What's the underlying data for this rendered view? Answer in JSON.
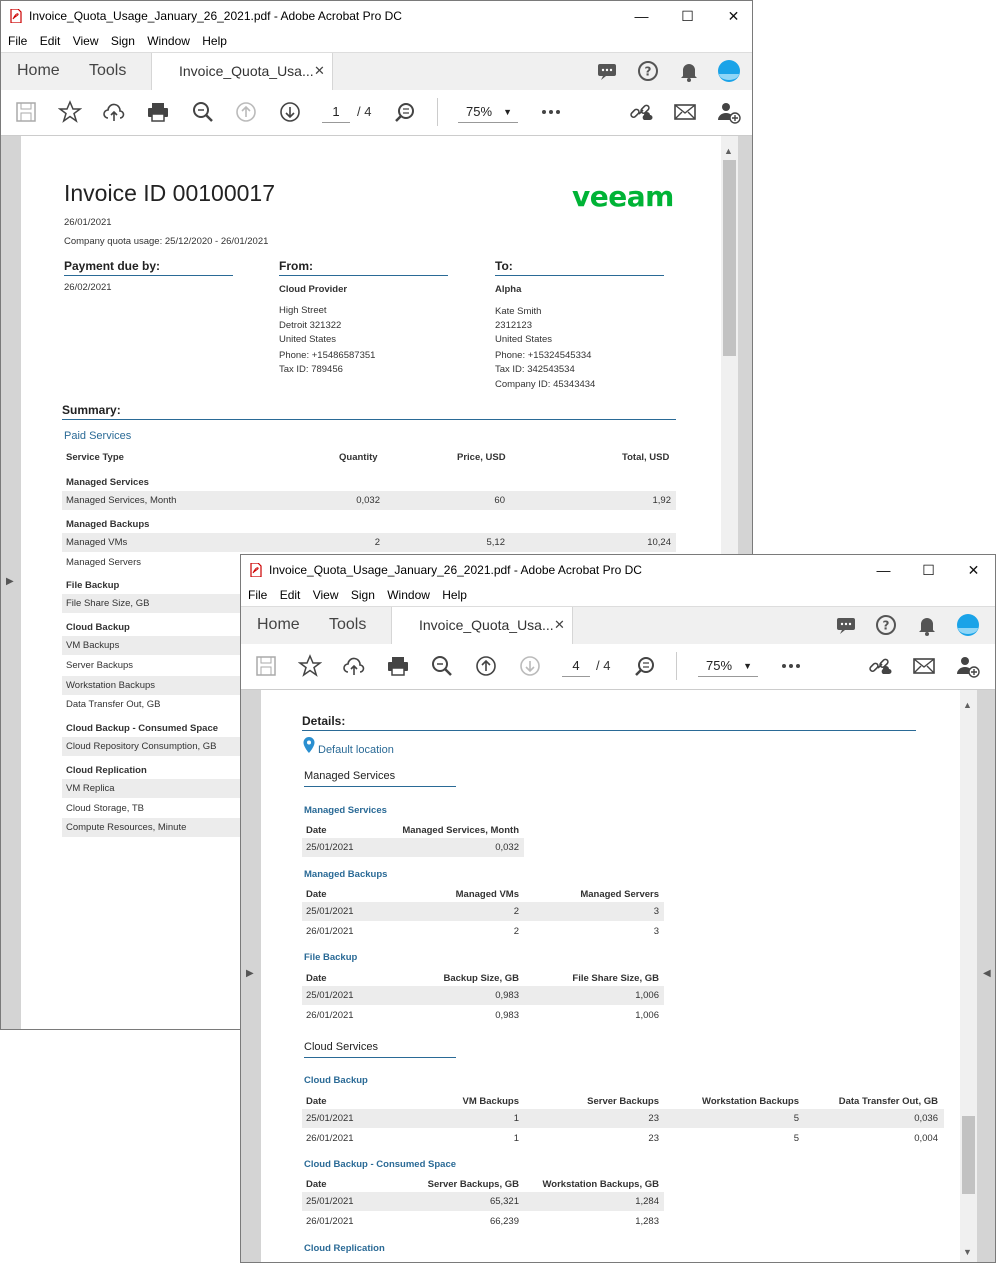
{
  "window1": {
    "title": "Invoice_Quota_Usage_January_26_2021.pdf - Adobe Acrobat Pro DC",
    "menu": [
      "File",
      "Edit",
      "View",
      "Sign",
      "Window",
      "Help"
    ],
    "tabs": {
      "home": "Home",
      "tools": "Tools",
      "doc": "Invoice_Quota_Usa..."
    },
    "page_current": "1",
    "page_total": "/ 4",
    "zoom": "75%"
  },
  "window2": {
    "title": "Invoice_Quota_Usage_January_26_2021.pdf - Adobe Acrobat Pro DC",
    "menu": [
      "File",
      "Edit",
      "View",
      "Sign",
      "Window",
      "Help"
    ],
    "tabs": {
      "home": "Home",
      "tools": "Tools",
      "doc": "Invoice_Quota_Usa..."
    },
    "page_current": "4",
    "page_total": "/ 4",
    "zoom": "75%"
  },
  "invoice": {
    "title": "Invoice ID 00100017",
    "logo": "veeam",
    "date": "26/01/2021",
    "quota": "Company quota usage: 25/12/2020 - 26/01/2021",
    "payment_due_label": "Payment due by:",
    "payment_due": "26/02/2021",
    "from_label": "From:",
    "from": {
      "name": "Cloud Provider",
      "street": "High Street",
      "city": "Detroit 321322",
      "country": "United States",
      "phone": "Phone: +15486587351",
      "tax": "Tax ID: 789456"
    },
    "to_label": "To:",
    "to": {
      "name": "Alpha",
      "person": "Kate Smith",
      "zip": "2312123",
      "country": "United States",
      "phone": "Phone: +15324545334",
      "tax": "Tax ID: 342543534",
      "company": "Company ID: 45343434"
    },
    "summary_label": "Summary:",
    "paid_services": "Paid Services",
    "columns": [
      "Service Type",
      "Quantity",
      "Price, USD",
      "Total, USD"
    ],
    "rows": [
      {
        "group": "Managed Services"
      },
      {
        "name": "Managed Services, Month",
        "qty": "0,032",
        "price": "60",
        "total": "1,92",
        "shade": true
      },
      {
        "group": "Managed Backups"
      },
      {
        "name": "Managed VMs",
        "qty": "2",
        "price": "5,12",
        "total": "10,24",
        "shade": true
      },
      {
        "name": "Managed Servers",
        "qty": "",
        "price": "",
        "total": "",
        "shade": false
      },
      {
        "group": "File Backup"
      },
      {
        "name": "File Share Size, GB",
        "shade": true
      },
      {
        "group": "Cloud Backup"
      },
      {
        "name": "VM Backups",
        "shade": true
      },
      {
        "name": "Server Backups",
        "shade": false
      },
      {
        "name": "Workstation Backups",
        "shade": true
      },
      {
        "name": "Data Transfer Out, GB",
        "shade": false
      },
      {
        "group": "Cloud Backup - Consumed Space"
      },
      {
        "name": "Cloud Repository Consumption, GB",
        "shade": true
      },
      {
        "group": "Cloud Replication"
      },
      {
        "name": "VM Replica",
        "shade": true
      },
      {
        "name": "Cloud Storage, TB",
        "shade": false
      },
      {
        "name": "Compute Resources, Minute",
        "shade": true
      }
    ]
  },
  "details": {
    "label": "Details:",
    "location": "Default location",
    "managed_services_group": "Managed Services",
    "ms_table": {
      "title": "Managed Services",
      "cols": [
        "Date",
        "Managed Services, Month"
      ],
      "rows": [
        [
          "25/01/2021",
          "0,032"
        ]
      ]
    },
    "mb_table": {
      "title": "Managed Backups",
      "cols": [
        "Date",
        "Managed VMs",
        "Managed Servers"
      ],
      "rows": [
        [
          "25/01/2021",
          "2",
          "3"
        ],
        [
          "26/01/2021",
          "2",
          "3"
        ]
      ]
    },
    "fb_table": {
      "title": "File Backup",
      "cols": [
        "Date",
        "Backup Size, GB",
        "File Share Size, GB"
      ],
      "rows": [
        [
          "25/01/2021",
          "0,983",
          "1,006"
        ],
        [
          "26/01/2021",
          "0,983",
          "1,006"
        ]
      ]
    },
    "cloud_services_group": "Cloud Services",
    "cb_table": {
      "title": "Cloud Backup",
      "cols": [
        "Date",
        "VM Backups",
        "Server Backups",
        "Workstation Backups",
        "Data Transfer Out, GB"
      ],
      "rows": [
        [
          "25/01/2021",
          "1",
          "23",
          "5",
          "0,036"
        ],
        [
          "26/01/2021",
          "1",
          "23",
          "5",
          "0,004"
        ]
      ]
    },
    "cbcs_table": {
      "title": "Cloud Backup - Consumed Space",
      "cols": [
        "Date",
        "Server Backups, GB",
        "Workstation Backups, GB"
      ],
      "rows": [
        [
          "25/01/2021",
          "65,321",
          "1,284"
        ],
        [
          "26/01/2021",
          "66,239",
          "1,283"
        ]
      ]
    },
    "cr_title": "Cloud Replication"
  }
}
